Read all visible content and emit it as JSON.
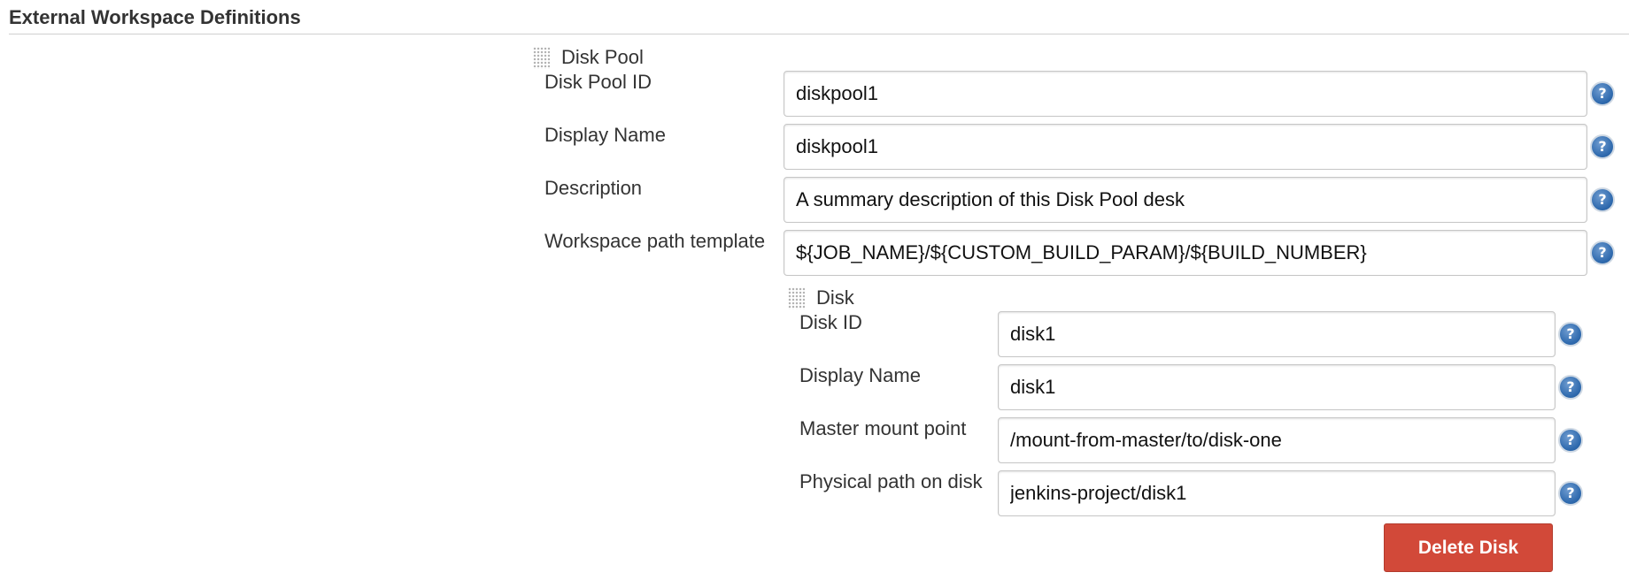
{
  "section": {
    "title": "External Workspace Definitions"
  },
  "disk_pool": {
    "title": "Disk Pool",
    "fields": [
      {
        "label": "Disk Pool ID",
        "value": "diskpool1"
      },
      {
        "label": "Display Name",
        "value": "diskpool1"
      },
      {
        "label": "Description",
        "value": "A summary description of this Disk Pool desk"
      },
      {
        "label": "Workspace path template",
        "value": "${JOB_NAME}/${CUSTOM_BUILD_PARAM}/${BUILD_NUMBER}"
      }
    ]
  },
  "disk": {
    "title": "Disk",
    "fields": [
      {
        "label": "Disk ID",
        "value": "disk1"
      },
      {
        "label": "Display Name",
        "value": "disk1"
      },
      {
        "label": "Master mount point",
        "value": "/mount-from-master/to/disk-one"
      },
      {
        "label": "Physical path on disk",
        "value": "jenkins-project/disk1"
      }
    ],
    "delete_label": "Delete Disk"
  },
  "help": {
    "glyph": "?"
  },
  "icons": {
    "grip": "drag-handle-icon",
    "help": "help-icon"
  },
  "colors": {
    "delete_button": "#d24939",
    "help_icon": "#2f6aae",
    "input_border": "#c6c6c6",
    "divider": "#d0d0d0"
  }
}
